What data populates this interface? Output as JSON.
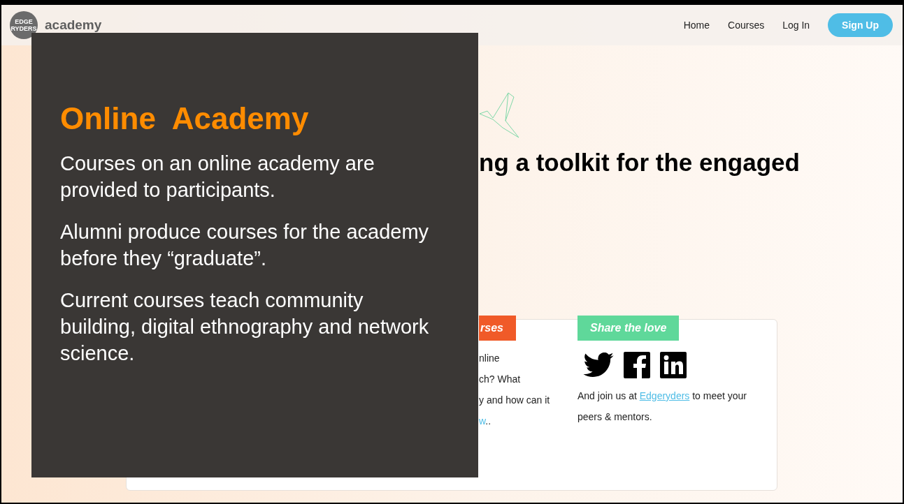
{
  "header": {
    "logo": "EDGE RYDERS",
    "site_name": "academy",
    "nav": [
      {
        "label": "Home",
        "kind": "link"
      },
      {
        "label": "Courses",
        "kind": "link"
      },
      {
        "label": "Log In",
        "kind": "link"
      },
      {
        "label": "Sign Up",
        "kind": "button"
      }
    ]
  },
  "hero": {
    "heading": "ng a toolkit for the engaged"
  },
  "sections": [
    {
      "kind": "text",
      "tag": "rses",
      "color": "#f05a28",
      "lines": [
        "nline",
        "ch? What",
        "y and how can it"
      ],
      "link": "w",
      "text_after": ".."
    },
    {
      "kind": "share",
      "tag": "Share the love",
      "color": "#5fd89a",
      "text_before": "And join us at ",
      "link": "Edgeryders",
      "text_after": " to meet your peers & mentors."
    }
  ],
  "overlay": {
    "title": "Online  Academy",
    "paragraphs": [
      "Courses on an  online academy are provided to participants.",
      "Alumni produce courses for the academy before they “graduate”.",
      "Current courses teach community building, digital ethnography and network science."
    ]
  }
}
